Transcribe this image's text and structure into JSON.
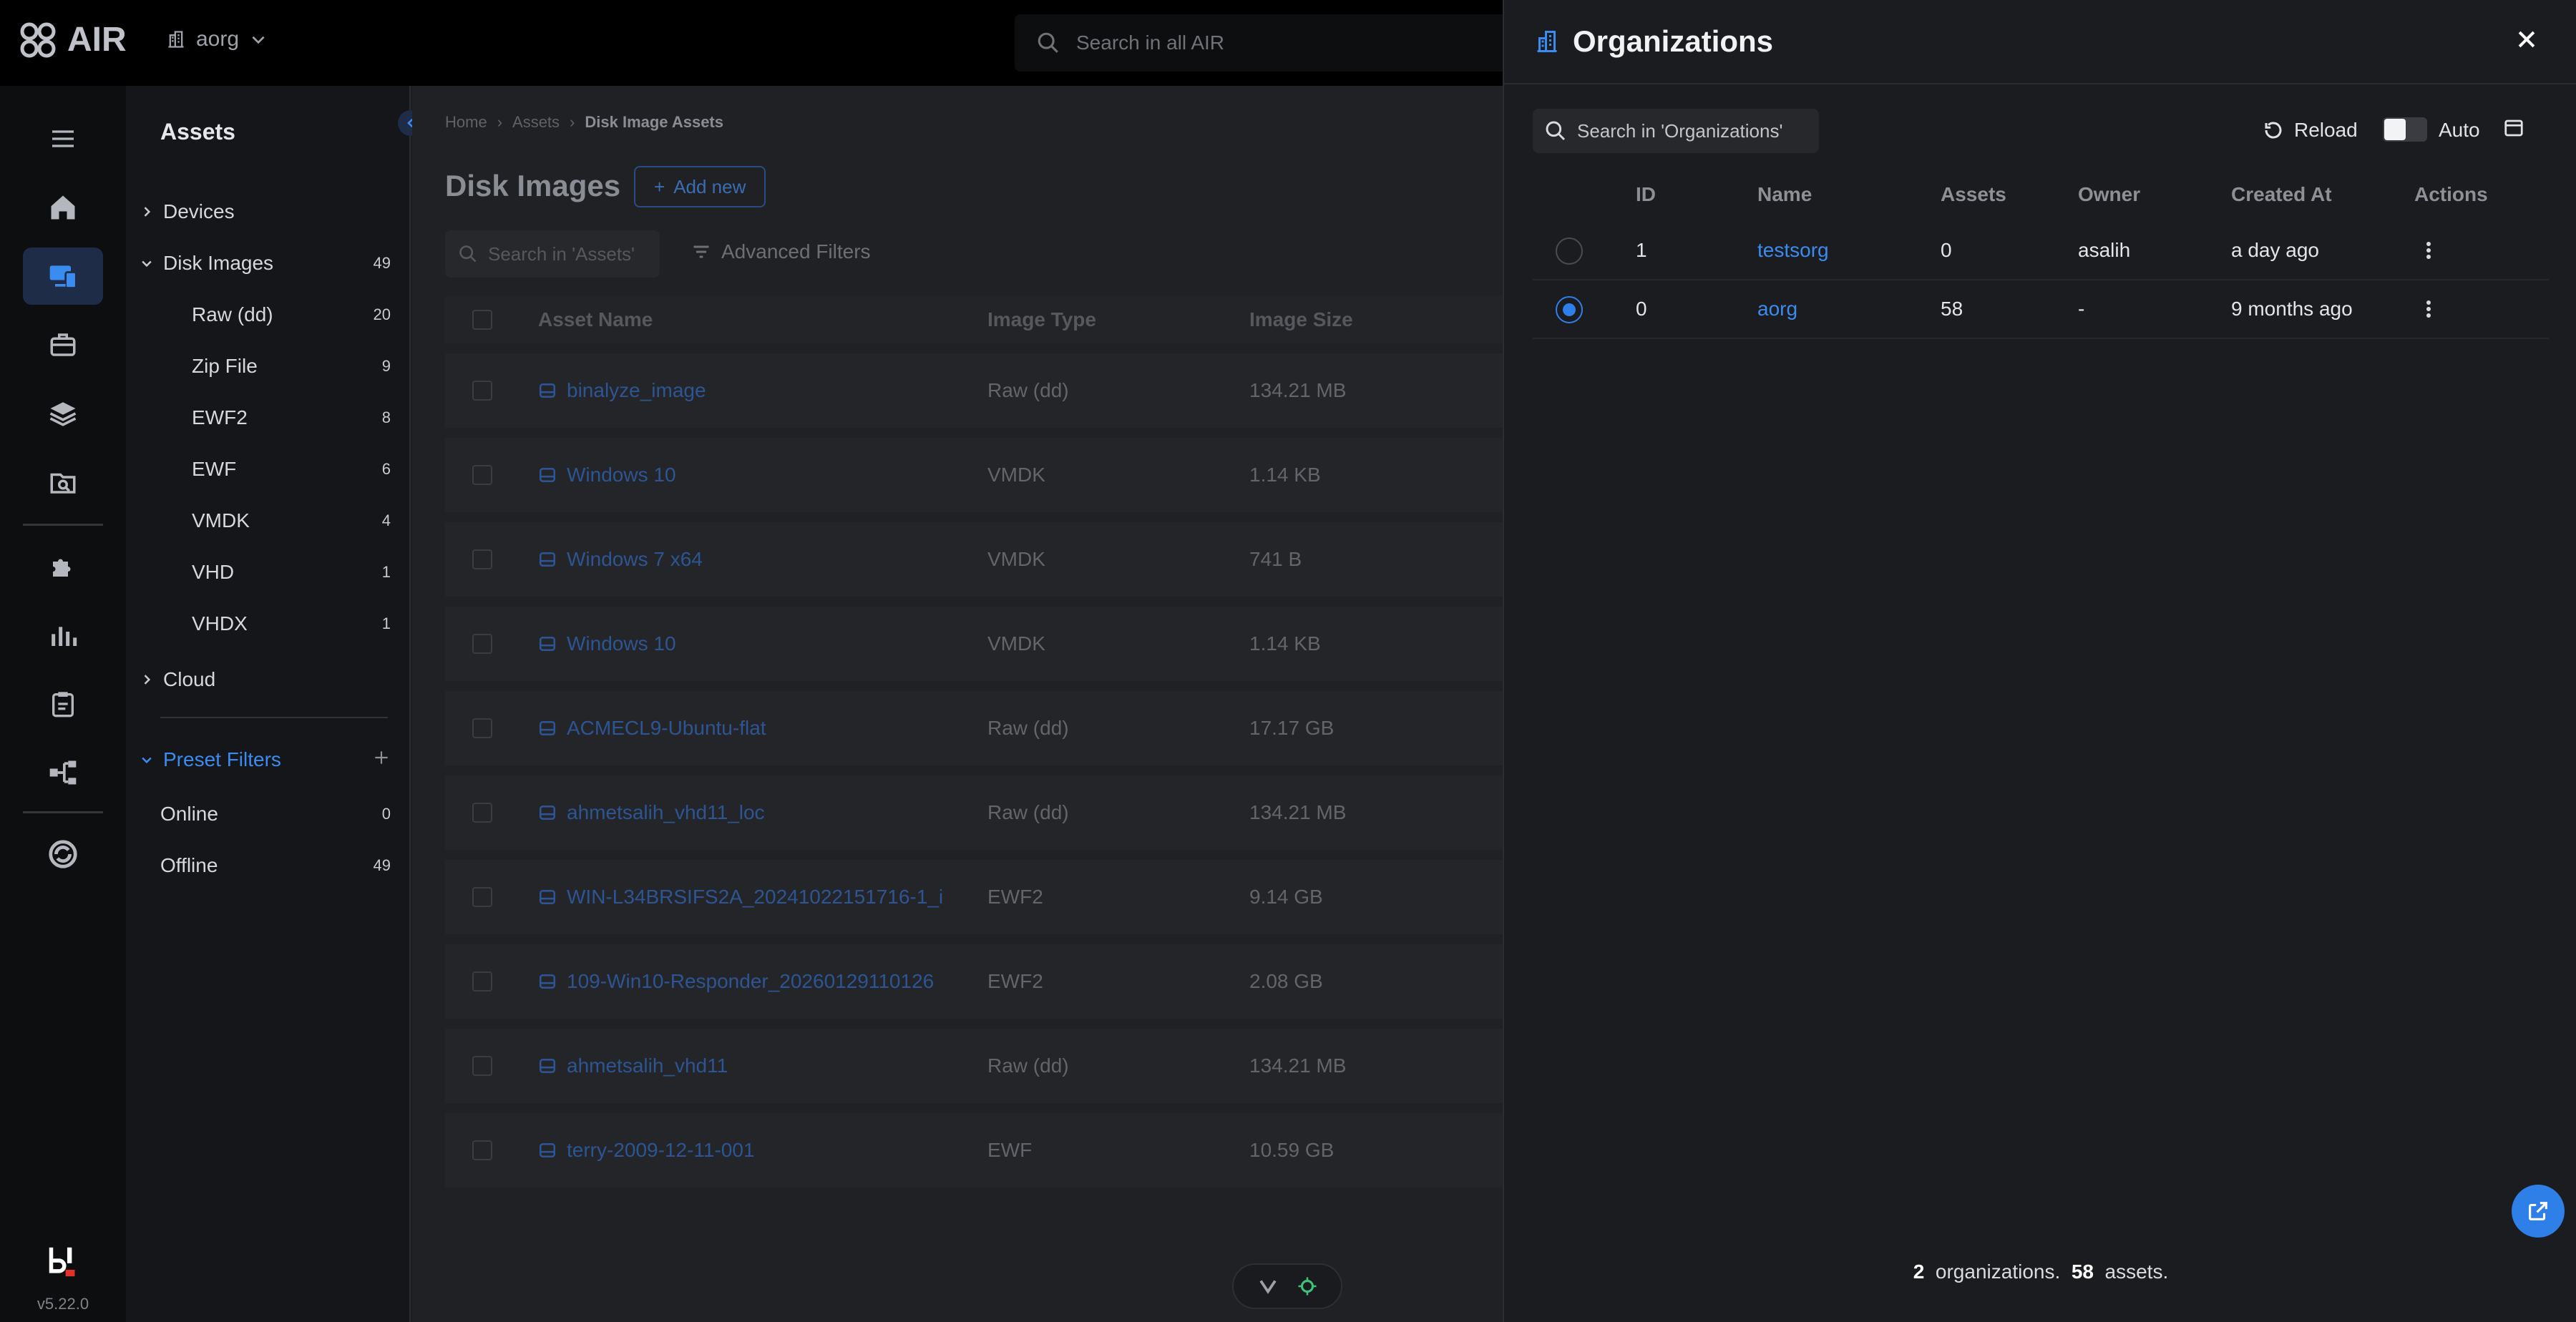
{
  "app": {
    "name": "AIR",
    "version": "v5.22.0"
  },
  "topbar": {
    "org": "aorg",
    "search_placeholder": "Search in all AIR"
  },
  "nav": {
    "title": "Assets",
    "devices": "Devices",
    "disk_images": {
      "label": "Disk Images",
      "count": "49"
    },
    "disk_children": [
      {
        "label": "Raw (dd)",
        "count": "20"
      },
      {
        "label": "Zip File",
        "count": "9"
      },
      {
        "label": "EWF2",
        "count": "8"
      },
      {
        "label": "EWF",
        "count": "6"
      },
      {
        "label": "VMDK",
        "count": "4"
      },
      {
        "label": "VHD",
        "count": "1"
      },
      {
        "label": "VHDX",
        "count": "1"
      }
    ],
    "cloud": "Cloud",
    "preset_filters": "Preset Filters",
    "presets": [
      {
        "label": "Online",
        "count": "0"
      },
      {
        "label": "Offline",
        "count": "49"
      }
    ]
  },
  "main": {
    "breadcrumb": [
      "Home",
      "Assets",
      "Disk Image Assets"
    ],
    "title": "Disk Images",
    "add_new": "Add new",
    "search_placeholder": "Search in 'Assets'",
    "advanced_filters": "Advanced Filters",
    "columns": [
      "Asset Name",
      "Image Type",
      "Image Size"
    ],
    "rows": [
      {
        "name": "binalyze_image",
        "type": "Raw (dd)",
        "size": "134.21 MB"
      },
      {
        "name": "Windows 10",
        "type": "VMDK",
        "size": "1.14 KB"
      },
      {
        "name": "Windows 7 x64",
        "type": "VMDK",
        "size": "741 B"
      },
      {
        "name": "Windows 10",
        "type": "VMDK",
        "size": "1.14 KB"
      },
      {
        "name": "ACMECL9-Ubuntu-flat",
        "type": "Raw (dd)",
        "size": "17.17 GB"
      },
      {
        "name": "ahmetsalih_vhd11_loc",
        "type": "Raw (dd)",
        "size": "134.21 MB"
      },
      {
        "name": "WIN-L34BRSIFS2A_20241022151716-1_i",
        "type": "EWF2",
        "size": "9.14 GB"
      },
      {
        "name": "109-Win10-Responder_20260129110126",
        "type": "EWF2",
        "size": "2.08 GB"
      },
      {
        "name": "ahmetsalih_vhd11",
        "type": "Raw (dd)",
        "size": "134.21 MB"
      },
      {
        "name": "terry-2009-12-11-001",
        "type": "EWF",
        "size": "10.59 GB"
      }
    ]
  },
  "panel": {
    "title": "Organizations",
    "search_placeholder": "Search in 'Organizations'",
    "reload": "Reload",
    "auto": "Auto",
    "columns": {
      "id": "ID",
      "name": "Name",
      "assets": "Assets",
      "owner": "Owner",
      "created": "Created At",
      "actions": "Actions"
    },
    "rows": [
      {
        "id": "1",
        "name": "testsorg",
        "assets": "0",
        "owner": "asalih",
        "created": "a day ago",
        "selected": false
      },
      {
        "id": "0",
        "name": "aorg",
        "assets": "58",
        "owner": "-",
        "created": "9 months ago",
        "selected": true
      }
    ],
    "footer": {
      "org_count": "2",
      "org_label": "organizations.",
      "asset_count": "58",
      "asset_label": "assets."
    }
  },
  "colors": {
    "accent": "#3b8cf0",
    "background": "#1b1d21",
    "topbar": "#000000"
  }
}
